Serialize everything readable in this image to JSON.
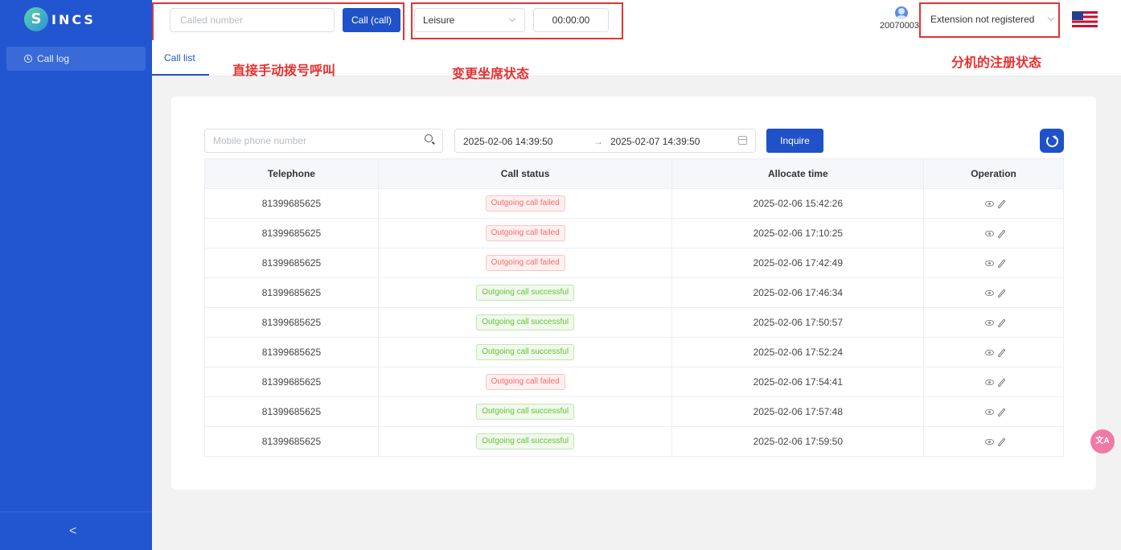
{
  "app": {
    "logo_text": "INCS"
  },
  "sidebar": {
    "items": [
      {
        "label": "Call log",
        "icon": "clock-icon"
      }
    ],
    "collapse_label": "<"
  },
  "header": {
    "called_placeholder": "Called number",
    "call_button": "Call (call)",
    "agent_status": "Leisure",
    "timer": "00:00:00",
    "user_id": "20070003",
    "extension_status": "Extension not registered",
    "language_flag": "us-flag-icon"
  },
  "annotations": {
    "manual_dial": "直接手动拨号呼叫",
    "change_status": "变更坐席状态",
    "extension_registration": "分机的注册状态",
    "color": "#e53333"
  },
  "tabs": [
    {
      "label": "Call list",
      "active": true
    }
  ],
  "filters": {
    "mobile_placeholder": "Mobile phone number",
    "date_start": "2025-02-06 14:39:50",
    "date_separator": "→",
    "date_end": "2025-02-07 14:39:50",
    "inquire_button": "Inquire"
  },
  "table": {
    "columns": [
      "Telephone",
      "Call status",
      "Allocate time",
      "Operation"
    ],
    "rows": [
      {
        "telephone": "81399685625",
        "status": "Outgoing call failed",
        "status_type": "fail",
        "time": "2025-02-06 15:42:26"
      },
      {
        "telephone": "81399685625",
        "status": "Outgoing call failed",
        "status_type": "fail",
        "time": "2025-02-06 17:10:25"
      },
      {
        "telephone": "81399685625",
        "status": "Outgoing call failed",
        "status_type": "fail",
        "time": "2025-02-06 17:42:49"
      },
      {
        "telephone": "81399685625",
        "status": "Outgoing call successful",
        "status_type": "ok",
        "time": "2025-02-06 17:46:34"
      },
      {
        "telephone": "81399685625",
        "status": "Outgoing call successful",
        "status_type": "ok",
        "time": "2025-02-06 17:50:57"
      },
      {
        "telephone": "81399685625",
        "status": "Outgoing call successful",
        "status_type": "ok",
        "time": "2025-02-06 17:52:24"
      },
      {
        "telephone": "81399685625",
        "status": "Outgoing call failed",
        "status_type": "fail",
        "time": "2025-02-06 17:54:41"
      },
      {
        "telephone": "81399685625",
        "status": "Outgoing call successful",
        "status_type": "ok",
        "time": "2025-02-06 17:57:48"
      },
      {
        "telephone": "81399685625",
        "status": "Outgoing call successful",
        "status_type": "ok",
        "time": "2025-02-06 17:59:50"
      }
    ]
  },
  "floating": {
    "label": "文A"
  },
  "colors": {
    "primary": "#2255d0",
    "fail": "#f56c6c",
    "ok": "#67c23a"
  }
}
